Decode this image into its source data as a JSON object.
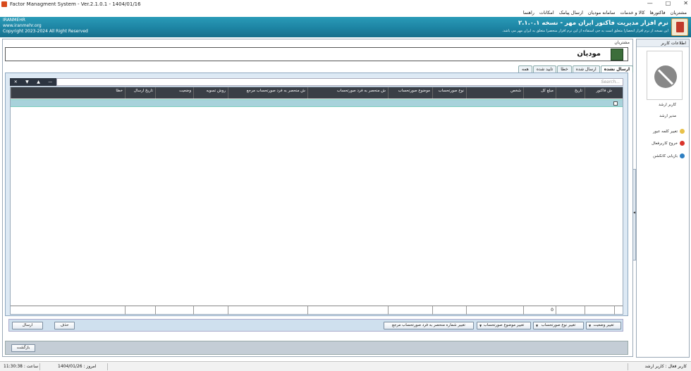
{
  "window": {
    "title": "Factor Managment System - Ver.2.1.0.1 - 1404/01/16",
    "min": "—",
    "max": "□",
    "close": "✕"
  },
  "menu": [
    "مشتریان",
    "فاکتورها",
    "کالا و خدمات",
    "سامانه مودیان",
    "ارسال پیامک",
    "امکانات",
    "راهنما"
  ],
  "banner": {
    "company": "IRANMEHR",
    "website": "www.iranmehr.org",
    "copyright": "Copyright 2023-2024 All Right Reserved",
    "product_title": "نرم افزار مدیریت فاکتور ایران مهر - نسخه ۲.۱.۰.۱",
    "product_sub": "این نسخه از نرم افزار انحصارا متعلق است به جی استفاده از این نرم افزار منحصرا متعلق به ایران مهر می باشد."
  },
  "section_label": "مشتریان",
  "page_title": "مودیان",
  "tabs": [
    "ارسال نشده",
    "ارسال شده",
    "خطا",
    "تایید شده",
    "همه"
  ],
  "active_tab": 0,
  "grid": {
    "toolbar_buttons": [
      "✕",
      "▼",
      "▲",
      "—"
    ],
    "search_placeholder": "Search...",
    "columns": [
      "ش فاکتور",
      "تاریخ",
      "مبلغ کل",
      "شخص",
      "نوع صورتحساب",
      "موضوع صورتحساب",
      "ش منحصر به فرد صورتحساب",
      "ش منحصر به فرد صورتحساب مرجع",
      "روش تسویه",
      "وضعیت",
      "تاریخ ارسال",
      "خطا"
    ],
    "footer_total": "0"
  },
  "actions": {
    "change_status": "تغییر وضعیت",
    "change_type": "تغییر نوع صورتحساب",
    "change_subject": "تغییر موضوع صورتحساب",
    "change_ref_number": "تغییر شماره منحصر به فرد صورتحساب مرجع",
    "delete": "حذف",
    "send": "ارسال"
  },
  "back_button": "بازگشت",
  "sidebar": {
    "header": "اطلاعات کاربر",
    "user_name": "کاربر ارشد",
    "user_role": "مدیر ارشد",
    "items": [
      "تغییر کلمه عبور",
      "خروج کاربرفعال",
      "بازیابی کانکشن"
    ]
  },
  "status": {
    "active_user": "کاربر فعال : کاربر ارشد",
    "date": "امروز : 1404/01/26",
    "time": "ساعت : 11:30:38"
  }
}
